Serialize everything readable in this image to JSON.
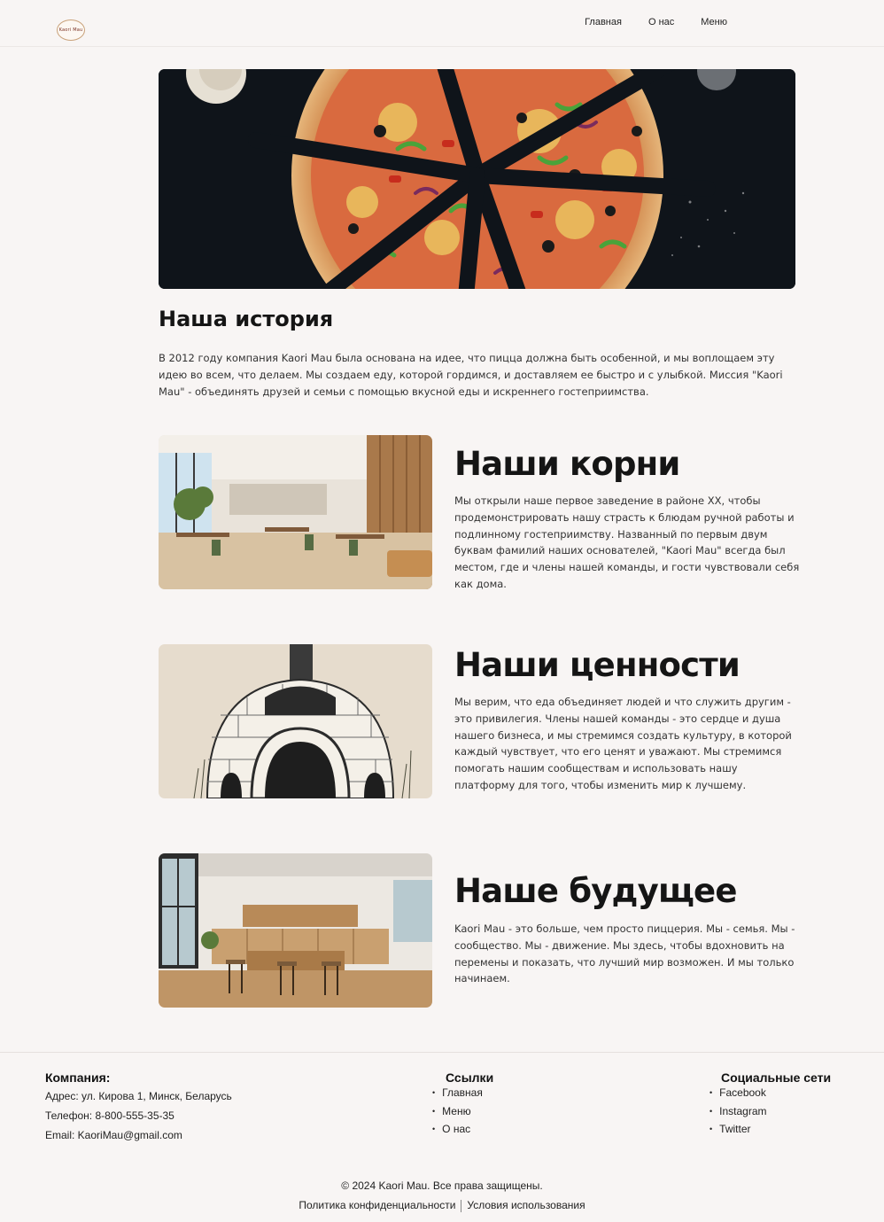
{
  "header": {
    "logo_text": "Kaori Mau",
    "nav": [
      {
        "label": "Главная"
      },
      {
        "label": "О нас"
      },
      {
        "label": "Меню"
      }
    ]
  },
  "hero": {
    "image": "pizza-on-dark-table-image"
  },
  "story": {
    "title": "Наша история",
    "text": "В 2012 году компания Kaori Mau была основана на идее, что пицца должна быть особенной, и мы воплощаем эту идею во всем, что делаем.  Мы создаем еду, которой гордимся, и доставляем ее быстро и с улыбкой. Миссия \"Kaori Mau\" - объединять друзей и семьи с помощью вкусной еды и искреннего гостеприимства."
  },
  "sections": [
    {
      "title": "Наши корни",
      "image": "restaurant-interior-image",
      "text": "Мы открыли наше первое заведение в районе XX, чтобы продемонстрировать нашу страсть к блюдам ручной работы и подлинному гостеприимству. Названный по первым двум буквам фамилий наших основателей, \"Kaori Mau\" всегда был местом, где и члены нашей команды, и гости чувствовали себя как дома."
    },
    {
      "title": "Наши ценности",
      "image": "brick-pizza-oven-illustration",
      "text": "Мы верим, что еда объединяет людей и что служить другим - это привилегия. Члены нашей команды - это сердце и душа нашего бизнеса, и мы стремимся создать культуру, в которой каждый чувствует, что его ценят и уважают. Мы стремимся помогать нашим сообществам и использовать нашу платформу для того, чтобы изменить мир к лучшему."
    },
    {
      "title": "Наше будущее",
      "image": "modern-kitchen-image",
      "text": "Kaori Mau - это больше, чем просто пиццерия. Мы - семья. Мы - сообщество. Мы - движение. Мы здесь, чтобы вдохновить на перемены и показать, что лучший мир возможен. И мы только начинаем."
    }
  ],
  "footer": {
    "company": {
      "heading": "Компания:",
      "address": "Адрес: ул. Кирова 1, Минск, Беларусь",
      "phone": "Телефон: 8-800-555-35-35",
      "email": "Email: KaoriMau@gmail.com"
    },
    "links": {
      "heading": "Ссылки",
      "items": [
        "Главная",
        "Меню",
        "О нас"
      ]
    },
    "social": {
      "heading": "Социальные сети",
      "items": [
        "Facebook",
        "Instagram",
        "Twitter"
      ]
    },
    "copyright": "© 2024 Kaori Mau. Все права защищены.",
    "privacy": "Политика конфиденциальности",
    "terms": "Условия использования"
  }
}
